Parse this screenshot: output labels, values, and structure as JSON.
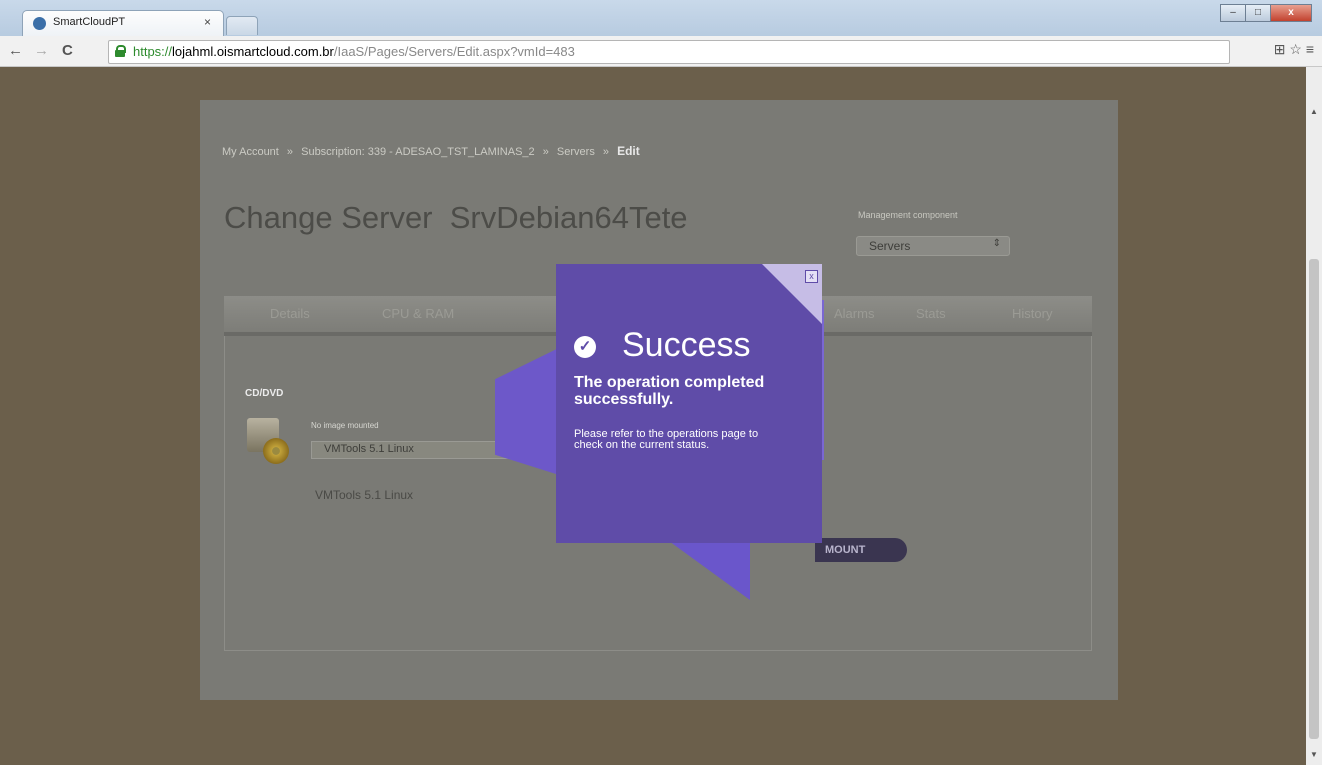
{
  "browser": {
    "tab_title": "SmartCloudPT",
    "tab_close": "×",
    "url_scheme": "https://",
    "url_host": "lojahml.oismartcloud.com.br",
    "url_path": "/IaaS/Pages/Servers/Edit.aspx?vmId=483",
    "window_buttons": {
      "minimize": "–",
      "maximize": "□",
      "close": "x"
    },
    "back": "←",
    "forward": "→",
    "reload": "C",
    "extensions": "⊞ ☆ ≡"
  },
  "breadcrumb": {
    "items": [
      "My Account",
      "Subscription: 339 - ADESAO_TST_LAMINAS_2",
      "Servers"
    ],
    "separator": "»",
    "current": "Edit"
  },
  "page": {
    "title": "Change Server  SrvDebian64Tete",
    "management_label": "Management component",
    "management_value": "Servers",
    "tabs": [
      "Details",
      "CPU & RAM",
      "Alarms",
      "Stats",
      "History"
    ]
  },
  "cd": {
    "label": "CD/DVD",
    "status": "No image mounted",
    "selected_image": "VMTools 5.1 Linux",
    "caption": "VMTools 5.1 Linux",
    "mount_label": "MOUNT"
  },
  "popup": {
    "heading": "Success",
    "message": "The operation completed successfully.",
    "detail": "Please refer to the operations page to check on the current status.",
    "close": "x"
  },
  "colors": {
    "popup_bg": "#5f4ca8",
    "backdrop": "#6b5f4b",
    "url_secure": "#2e8b2e"
  }
}
